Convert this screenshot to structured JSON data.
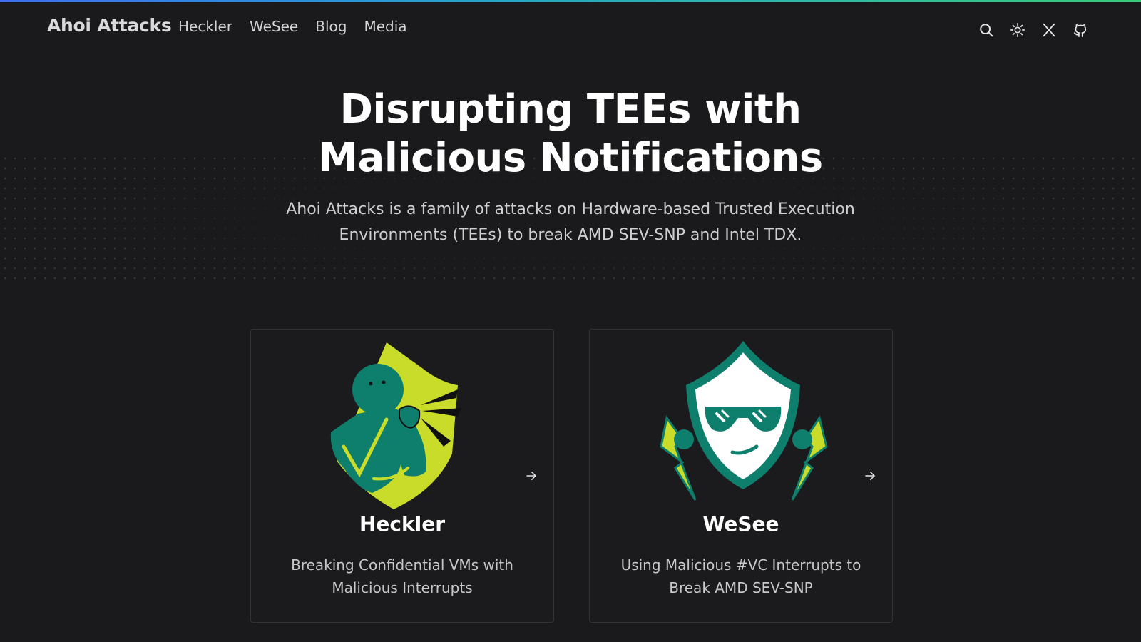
{
  "header": {
    "brand": "Ahoi Attacks",
    "nav": [
      "Heckler",
      "WeSee",
      "Blog",
      "Media"
    ],
    "icons": [
      "search-icon",
      "sun-icon",
      "x-logo-icon",
      "github-icon"
    ]
  },
  "hero": {
    "title": "Disrupting TEEs with Malicious Notifications",
    "subtitle": "Ahoi Attacks is a family of attacks on Hardware-based Trusted Execution Environments (TEEs) to break AMD SEV-SNP and Intel TDX."
  },
  "cards": [
    {
      "title": "Heckler",
      "description": "Breaking Confidential VMs with Malicious Interrupts",
      "icon": "arrow-right-icon"
    },
    {
      "title": "WeSee",
      "description": "Using Malicious #VC Interrupts to Break AMD SEV-SNP",
      "icon": "arrow-right-icon"
    }
  ],
  "colors": {
    "background": "#1a1a1c",
    "accent_green": "#0e7f6c",
    "accent_yellow": "#c9dc2a",
    "top_gradient_start": "#3b6ee8",
    "top_gradient_end": "#3cc97a"
  }
}
